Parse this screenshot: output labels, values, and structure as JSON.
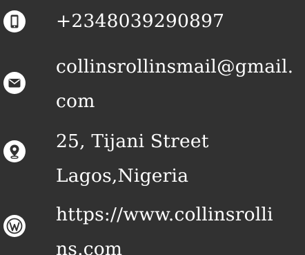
{
  "contact": {
    "phone": {
      "icon": "phone-icon",
      "text": "+2348039290897"
    },
    "email": {
      "icon": "envelope-icon",
      "line1": "collinsrollinsmail@gmail.",
      "line2": "com"
    },
    "address": {
      "icon": "location-pin-icon",
      "line1": "25, Tijani Street",
      "line2": "Lagos,Nigeria"
    },
    "website": {
      "icon": "wordpress-icon",
      "line1": "https://www.collinsrolli",
      "line2": "ns.com"
    }
  },
  "colors": {
    "background": "#313131",
    "text": "#ffffff",
    "icon_fill": "#ffffff",
    "icon_glyph": "#313131"
  }
}
